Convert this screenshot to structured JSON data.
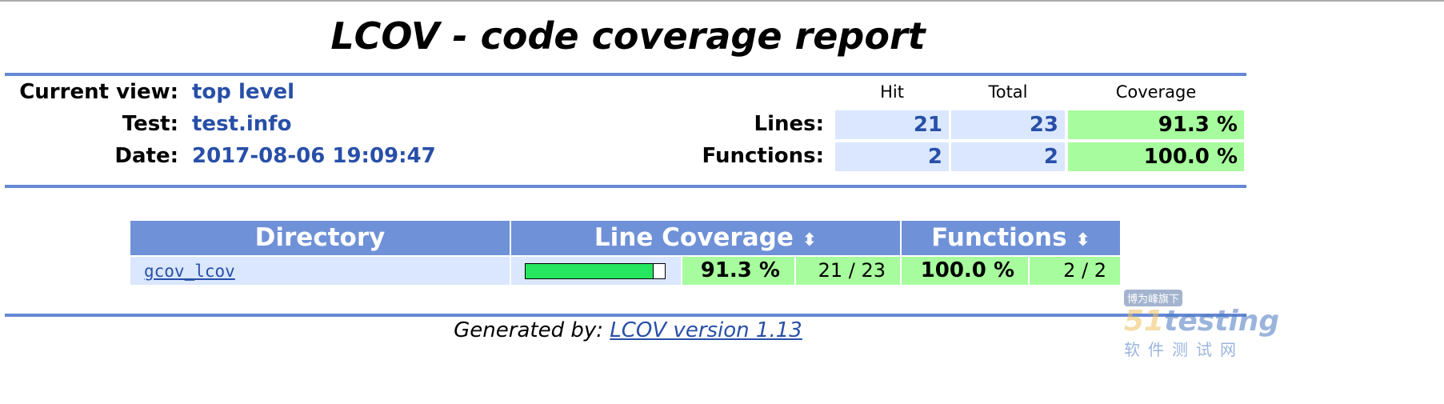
{
  "title": "LCOV - code coverage report",
  "info": {
    "current_view_label": "Current view:",
    "current_view": "top level",
    "test_label": "Test:",
    "test": "test.info",
    "date_label": "Date:",
    "date": "2017-08-06 19:09:47"
  },
  "summary": {
    "headers": [
      "Hit",
      "Total",
      "Coverage"
    ],
    "rows": [
      {
        "label": "Lines:",
        "hit": "21",
        "total": "23",
        "coverage": "91.3 %"
      },
      {
        "label": "Functions:",
        "hit": "2",
        "total": "2",
        "coverage": "100.0 %"
      }
    ]
  },
  "table": {
    "headers": {
      "directory": "Directory",
      "line_coverage": "Line Coverage",
      "functions": "Functions"
    },
    "rows": [
      {
        "directory": "gcov_lcov",
        "line_percent": 91.3,
        "line_percent_text": "91.3 %",
        "line_count": "21 / 23",
        "func_percent_text": "100.0 %",
        "func_count": "2 / 2"
      }
    ]
  },
  "footer": {
    "prefix": "Generated by:",
    "link": "LCOV version 1.13"
  },
  "watermark": {
    "tag": "博为峰旗下",
    "brand": "51testing",
    "sub": "软件测试网"
  },
  "colors": {
    "rule": "#6688d4",
    "header": "#6f91d7",
    "hi": "#a7fc9d",
    "bar": "#26e55f",
    "cellblue": "#dae7fe"
  }
}
